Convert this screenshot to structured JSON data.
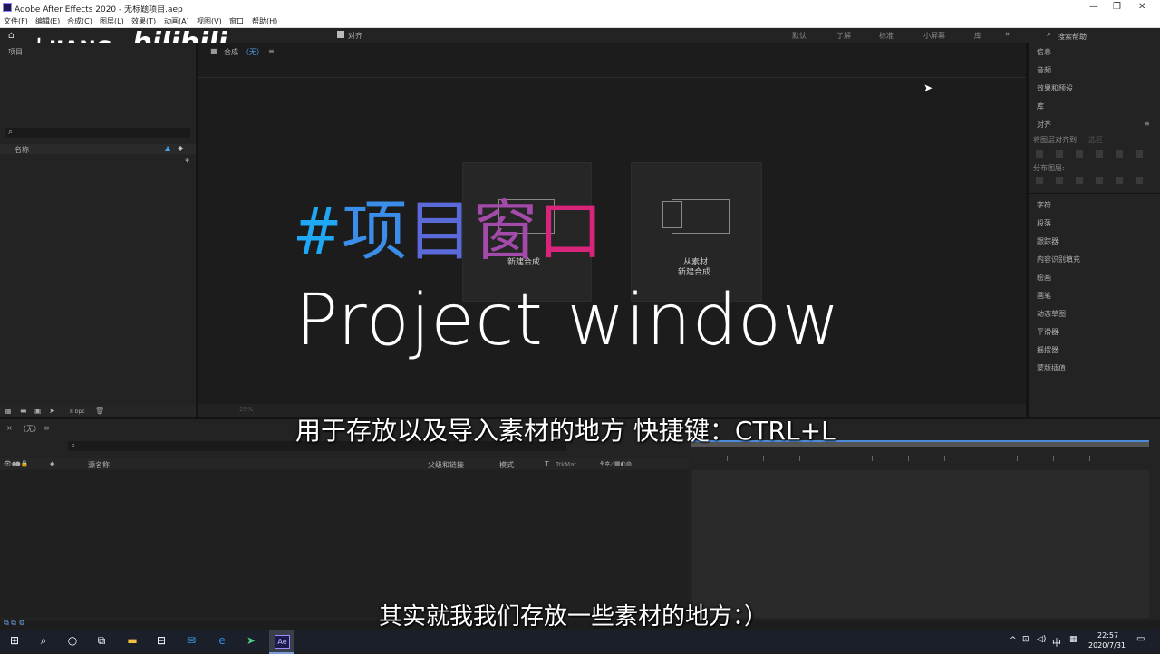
{
  "window": {
    "title": "Adobe After Effects 2020 - 无标题项目.aep",
    "controls": [
      "—",
      "❐",
      "✕"
    ]
  },
  "menubar": [
    "文件(F)",
    "编辑(E)",
    "合成(C)",
    "图层(L)",
    "效果(T)",
    "动画(A)",
    "视图(V)",
    "窗口",
    "帮助(H)"
  ],
  "toolbar": {
    "snap_label": "对齐",
    "workspaces": [
      "默认",
      "了解",
      "标准",
      "小屏幕",
      "库"
    ],
    "search_placeholder": "搜索帮助"
  },
  "watermark": {
    "brand": "大JIANG",
    "site": "bilibili"
  },
  "project_panel": {
    "title": "项目",
    "col_name": "名称",
    "bpc": "8 bpc"
  },
  "comp_panel": {
    "title": "合成",
    "comp_name": "（无）",
    "new_comp": "新建合成",
    "from_footage_line1": "从素材",
    "from_footage_line2": "新建合成",
    "zoom": "25%"
  },
  "right_panel": {
    "items": [
      "信息",
      "音频",
      "效果和预设",
      "库",
      "对齐",
      "将图层对齐到",
      "分布图层:",
      "字符",
      "段落",
      "跟踪器",
      "内容识别填充",
      "绘画",
      "画笔",
      "动态草图",
      "平滑器",
      "摇摆器",
      "蒙版插值"
    ],
    "align_to_value": "选区"
  },
  "timeline": {
    "comp_name": "（无）",
    "col_source": "源名称",
    "col_parent": "父级和链接",
    "col_mode": "模式",
    "col_t": "T",
    "col_trkmat": "TrkMat"
  },
  "overlay": {
    "hash": "#",
    "chars": [
      "项",
      "目",
      "窗",
      "口"
    ],
    "english": "Project window",
    "subtitle_top": "用于存放以及导入素材的地方 快捷键：CTRL+L",
    "subtitle_bottom": "其实就我我们存放一些素材的地方：）"
  },
  "taskbar": {
    "time": "22:57",
    "date": "2020/7/31",
    "ime": "中",
    "app_label": "Ae"
  },
  "colors": {
    "hash": "#1fa8f5",
    "xiang": "#3a8de8",
    "mu": "#5a6ad8",
    "chuang": "#a44aaa",
    "kou": "#d8247a"
  }
}
